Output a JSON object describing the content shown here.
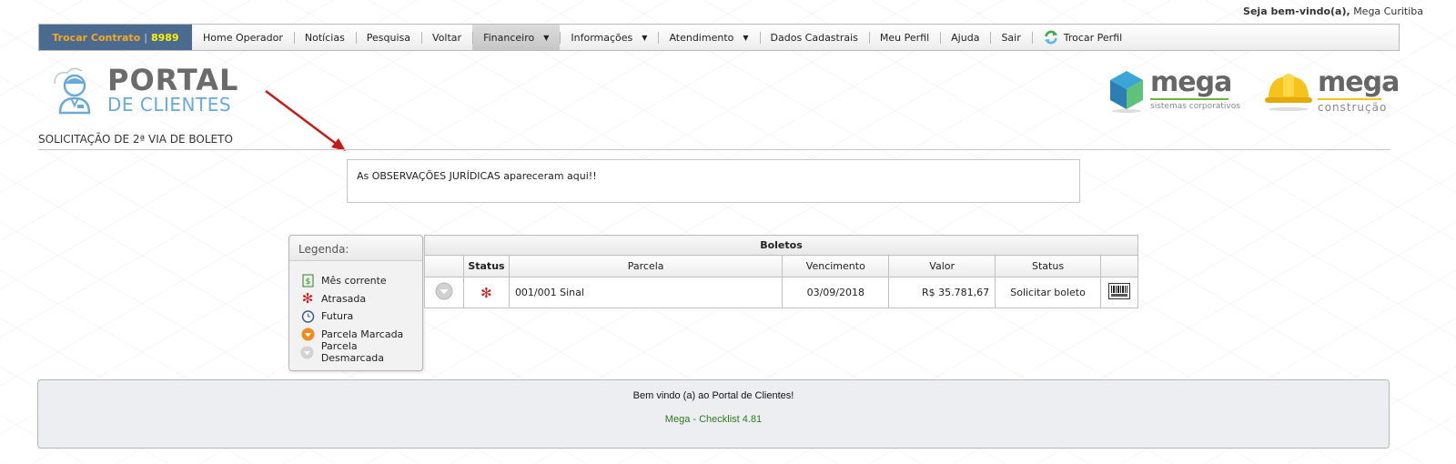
{
  "header": {
    "welcome_prefix": "Seja bem-vindo(a),",
    "welcome_user": "Mega Curitiba"
  },
  "nav": {
    "contract_label": "Trocar Contrato",
    "contract_separator": "|",
    "contract_number": "8989",
    "items": [
      {
        "label": "Home Operador"
      },
      {
        "label": "Notícias"
      },
      {
        "label": "Pesquisa"
      },
      {
        "label": "Voltar"
      },
      {
        "label": "Financeiro"
      },
      {
        "label": "Informações"
      },
      {
        "label": "Atendimento"
      },
      {
        "label": "Dados Cadastrais"
      },
      {
        "label": "Meu Perfil"
      },
      {
        "label": "Ajuda"
      },
      {
        "label": "Sair"
      },
      {
        "label": "Trocar Perfil"
      }
    ],
    "dropdown_caret": "▼"
  },
  "logos": {
    "portal_line1": "PORTAL",
    "portal_line2": "DE CLIENTES",
    "mega1_word": "mega",
    "mega1_sub": "sistemas corporativos",
    "mega2_word": "mega",
    "mega2_sub": "construção"
  },
  "page": {
    "title": "SOLICITAÇÃO DE 2ª VIA DE BOLETO",
    "observation": "As OBSERVAÇÕES JURÍDICAS apareceram aqui!!"
  },
  "legend": {
    "title": "Legenda:",
    "items": [
      {
        "label": "Mês corrente",
        "icon": "document-icon"
      },
      {
        "label": "Atrasada",
        "icon": "asterisk-icon"
      },
      {
        "label": "Futura",
        "icon": "clock-icon"
      },
      {
        "label": "Parcela Marcada",
        "icon": "orange-circle-down-icon"
      },
      {
        "label": "Parcela Desmarcada",
        "icon": "gray-circle-down-icon"
      }
    ]
  },
  "boletos": {
    "caption": "Boletos",
    "columns": [
      "",
      "Status",
      "Parcela",
      "Vencimento",
      "Valor",
      "Status",
      ""
    ],
    "rows": [
      {
        "parcela": "001/001 Sinal",
        "vencimento": "03/09/2018",
        "valor": "R$ 35.781,67",
        "status": "Solicitar boleto"
      }
    ]
  },
  "footer": {
    "line1": "Bem vindo (a) ao Portal de Clientes!",
    "line2": "Mega - Checklist 4.81"
  },
  "colors": {
    "contract_bg": "#4b6a8f",
    "contract_label": "#f5a623",
    "contract_number": "#fff200",
    "asterisk": "#cc1f1f",
    "footer_green": "#2c7a1d",
    "arrow": "#c41a1a"
  }
}
